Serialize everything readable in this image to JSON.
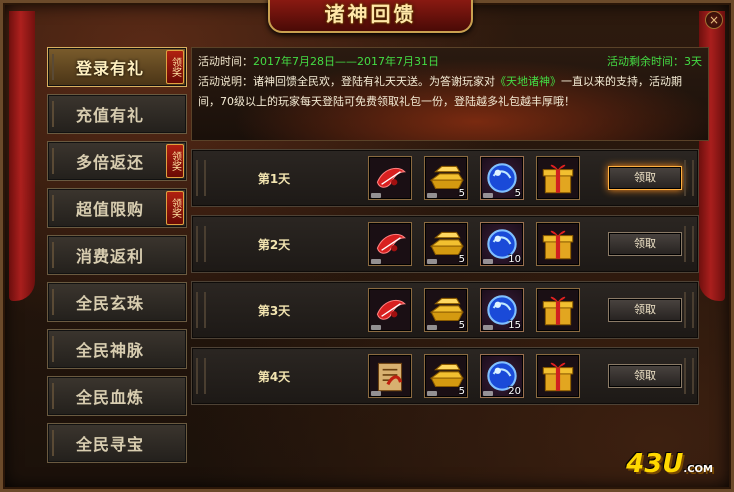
{
  "window": {
    "title": "诸神回馈",
    "close_glyph": "×"
  },
  "sidebar": {
    "items": [
      {
        "label": "登录有礼",
        "active": true,
        "claim_tag": "领奖"
      },
      {
        "label": "充值有礼",
        "active": false,
        "claim_tag": ""
      },
      {
        "label": "多倍返还",
        "active": false,
        "claim_tag": "领奖"
      },
      {
        "label": "超值限购",
        "active": false,
        "claim_tag": "领奖"
      },
      {
        "label": "消费返利",
        "active": false,
        "claim_tag": ""
      },
      {
        "label": "全民玄珠",
        "active": false,
        "claim_tag": ""
      },
      {
        "label": "全民神脉",
        "active": false,
        "claim_tag": ""
      },
      {
        "label": "全民血炼",
        "active": false,
        "claim_tag": ""
      },
      {
        "label": "全民寻宝",
        "active": false,
        "claim_tag": ""
      }
    ]
  },
  "info": {
    "time_label": "活动时间：",
    "time_value": "2017年7月28日——2017年7月31日",
    "remaining_label": "活动剩余时间：",
    "remaining_value": "3天",
    "desc_label": "活动说明：",
    "desc_part1": "诸神回馈全民欢，登陆有礼天天送。为答谢玩家对",
    "desc_highlight": "《天地诸神》",
    "desc_part2": "一直以来的支持，活动期间，70级以上的玩家每天登陆可免费领取礼包一份，登陆越多礼包越丰厚哦！"
  },
  "rewards": [
    {
      "day": "第1天",
      "items": [
        {
          "icon": "red-feather-icon",
          "count": ""
        },
        {
          "icon": "gold-ingot-icon",
          "count": "5"
        },
        {
          "icon": "blue-orb-icon",
          "count": "5"
        },
        {
          "icon": "gift-box-icon",
          "count": ""
        }
      ],
      "button": "领取",
      "highlight": true
    },
    {
      "day": "第2天",
      "items": [
        {
          "icon": "red-feather-icon",
          "count": ""
        },
        {
          "icon": "gold-ingot-icon",
          "count": "5"
        },
        {
          "icon": "blue-orb-icon",
          "count": "10"
        },
        {
          "icon": "gift-box-icon",
          "count": ""
        }
      ],
      "button": "领取",
      "highlight": false
    },
    {
      "day": "第3天",
      "items": [
        {
          "icon": "red-feather-icon",
          "count": ""
        },
        {
          "icon": "gold-ingot-icon",
          "count": "5"
        },
        {
          "icon": "blue-orb-icon",
          "count": "15"
        },
        {
          "icon": "gift-box-icon",
          "count": ""
        }
      ],
      "button": "领取",
      "highlight": false
    },
    {
      "day": "第4天",
      "items": [
        {
          "icon": "scroll-icon",
          "count": ""
        },
        {
          "icon": "gold-ingot-icon",
          "count": "5"
        },
        {
          "icon": "blue-orb-icon",
          "count": "20"
        },
        {
          "icon": "gift-box-icon",
          "count": ""
        }
      ],
      "button": "领取",
      "highlight": false
    }
  ],
  "brand": {
    "name": "43U",
    "suffix": ".COM"
  },
  "colors": {
    "accent_green": "#44dd44",
    "gold": "#d8b060",
    "claim_red": "#b02010"
  }
}
